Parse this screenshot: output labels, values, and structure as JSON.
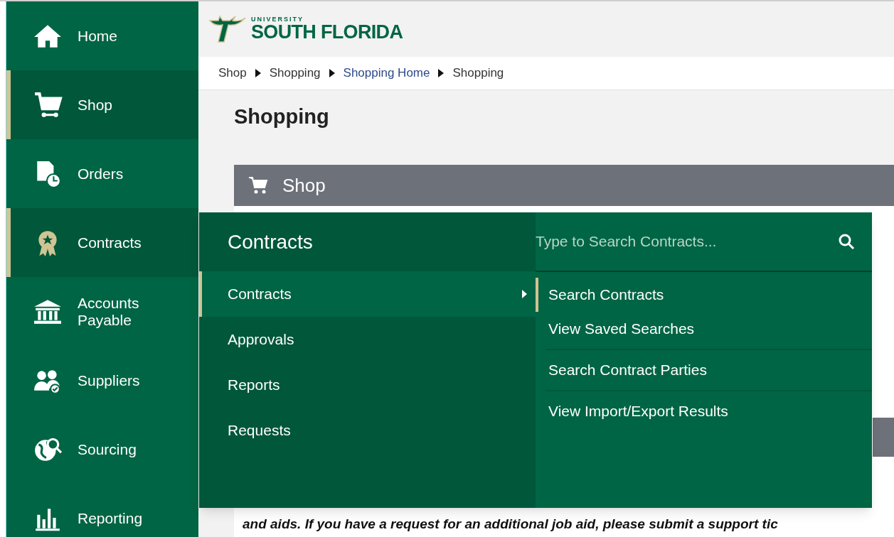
{
  "sidebar": {
    "items": [
      {
        "label": "Home",
        "selected": false
      },
      {
        "label": "Shop",
        "selected": true
      },
      {
        "label": "Orders",
        "selected": false
      },
      {
        "label": "Contracts",
        "selected": true
      },
      {
        "label": "Accounts Payable",
        "selected": false
      },
      {
        "label": "Suppliers",
        "selected": false
      },
      {
        "label": "Sourcing",
        "selected": false
      },
      {
        "label": "Reporting",
        "selected": false
      }
    ]
  },
  "logo": {
    "line_1": "UNIVERSITY",
    "line_2": "SOUTH FLORIDA"
  },
  "breadcrumb": [
    {
      "label": "Shop",
      "link": false
    },
    {
      "label": "Shopping",
      "link": false
    },
    {
      "label": "Shopping Home",
      "link": true
    },
    {
      "label": "Shopping",
      "link": false
    }
  ],
  "page_title": "Shopping",
  "panel": {
    "title": "Shop"
  },
  "notice": "and aids.  If you have a request for an additional job aid, please submit a support tic",
  "flyout": {
    "title": "Contracts",
    "items": [
      {
        "label": "Contracts",
        "selected": true,
        "submenu": true
      },
      {
        "label": "Approvals",
        "selected": false,
        "submenu": false
      },
      {
        "label": "Reports",
        "selected": false,
        "submenu": false
      },
      {
        "label": "Requests",
        "selected": false,
        "submenu": false
      }
    ],
    "search": {
      "placeholder": "Type to Search Contracts..."
    },
    "groups": [
      [
        {
          "label": "Search Contracts",
          "selected": true
        },
        {
          "label": "View Saved Searches",
          "selected": false
        }
      ],
      [
        {
          "label": "Search Contract Parties",
          "selected": false
        }
      ],
      [
        {
          "label": "View Import/Export Results",
          "selected": false
        }
      ]
    ]
  }
}
